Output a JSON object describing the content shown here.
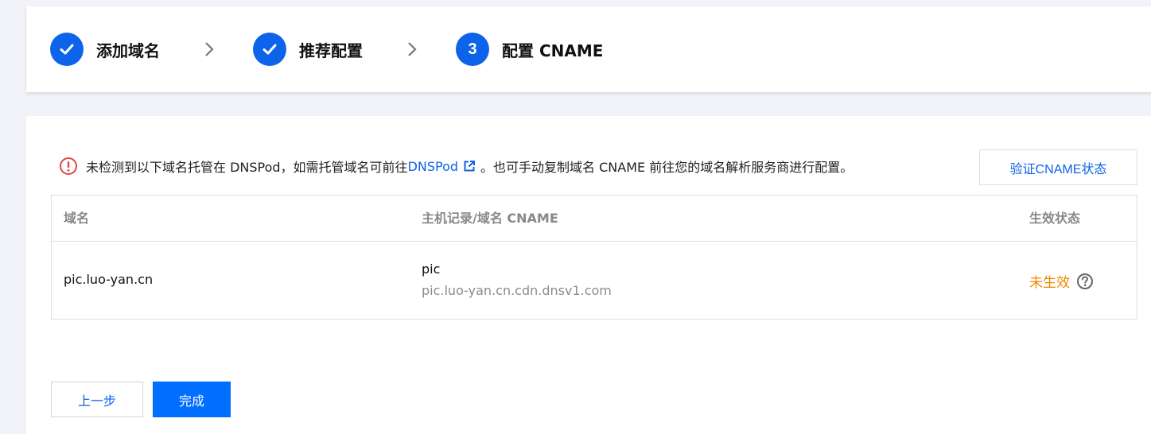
{
  "steps": [
    {
      "label": "添加域名",
      "state": "done",
      "icon": "check-icon"
    },
    {
      "label": "推荐配置",
      "state": "done",
      "icon": "check-icon"
    },
    {
      "label": "配置 CNAME",
      "state": "current",
      "number": "3"
    }
  ],
  "notice": {
    "icon": "error-circle-icon",
    "text_before": "未检测到以下域名托管在 DNSPod，如需托管域名可前往",
    "link_text": "DNSPod",
    "link_icon": "external-link-icon",
    "text_after": "。也可手动复制域名 CNAME 前往您的域名解析服务商进行配置。"
  },
  "verify_button": "验证CNAME状态",
  "table": {
    "headers": {
      "domain": "域名",
      "record": "主机记录/域名 CNAME",
      "status": "生效状态"
    },
    "rows": [
      {
        "domain": "pic.luo-yan.cn",
        "host_record": "pic",
        "cname": "pic.luo-yan.cn.cdn.dnsv1.com",
        "status": "未生效",
        "status_icon": "help-circle-icon"
      }
    ]
  },
  "buttons": {
    "prev": "上一步",
    "done": "完成"
  },
  "colors": {
    "primary": "#0d63ea",
    "warning": "#ef8a00",
    "error": "#e54545",
    "background": "#f2f3f8"
  }
}
